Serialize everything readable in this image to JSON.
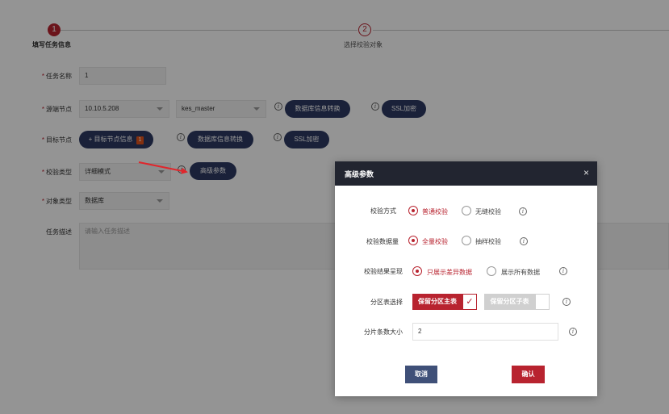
{
  "steps": [
    {
      "number": "1",
      "label": "填写任务信息"
    },
    {
      "number": "2",
      "label": "选择校验对象"
    }
  ],
  "form": {
    "task_name": {
      "label": "任务名称",
      "value": "1"
    },
    "source_node": {
      "label": "源端节点",
      "ip": "10.10.5.208",
      "db": "kes_master",
      "convert_button": "数据库信息转换",
      "ssl_button": "SSL加密"
    },
    "target_node": {
      "label": "目标节点",
      "add_button": "+ 目标节点信息",
      "badge": "1",
      "convert_button": "数据库信息转换",
      "ssl_button": "SSL加密"
    },
    "check_type": {
      "label": "校验类型",
      "value": "详细模式",
      "advanced_button": "高级参数"
    },
    "object_type": {
      "label": "对象类型",
      "value": "数据库"
    },
    "description": {
      "label": "任务描述",
      "placeholder": "请输入任务描述"
    }
  },
  "icons": {
    "info": "i",
    "close": "×",
    "check": "✓"
  },
  "modal": {
    "title": "高级参数",
    "rows": {
      "method": {
        "label": "校验方式",
        "options": [
          "普通校验",
          "无缝校验"
        ],
        "selected": 0
      },
      "volume": {
        "label": "校验数据量",
        "options": [
          "全量校验",
          "抽样校验"
        ],
        "selected": 0
      },
      "result": {
        "label": "校验结果呈现",
        "options": [
          "只展示差异数据",
          "展示所有数据"
        ],
        "selected": 0
      },
      "partition": {
        "label": "分区表选择",
        "keep_main": "保留分区主表",
        "keep_sub": "保留分区子表"
      },
      "shard": {
        "label": "分片条数大小",
        "value": "2"
      }
    },
    "cancel_label": "取消",
    "confirm_label": "确认"
  },
  "colors": {
    "accent": "#b8232f",
    "navy": "#2d3a63",
    "modal_header": "#222530"
  }
}
